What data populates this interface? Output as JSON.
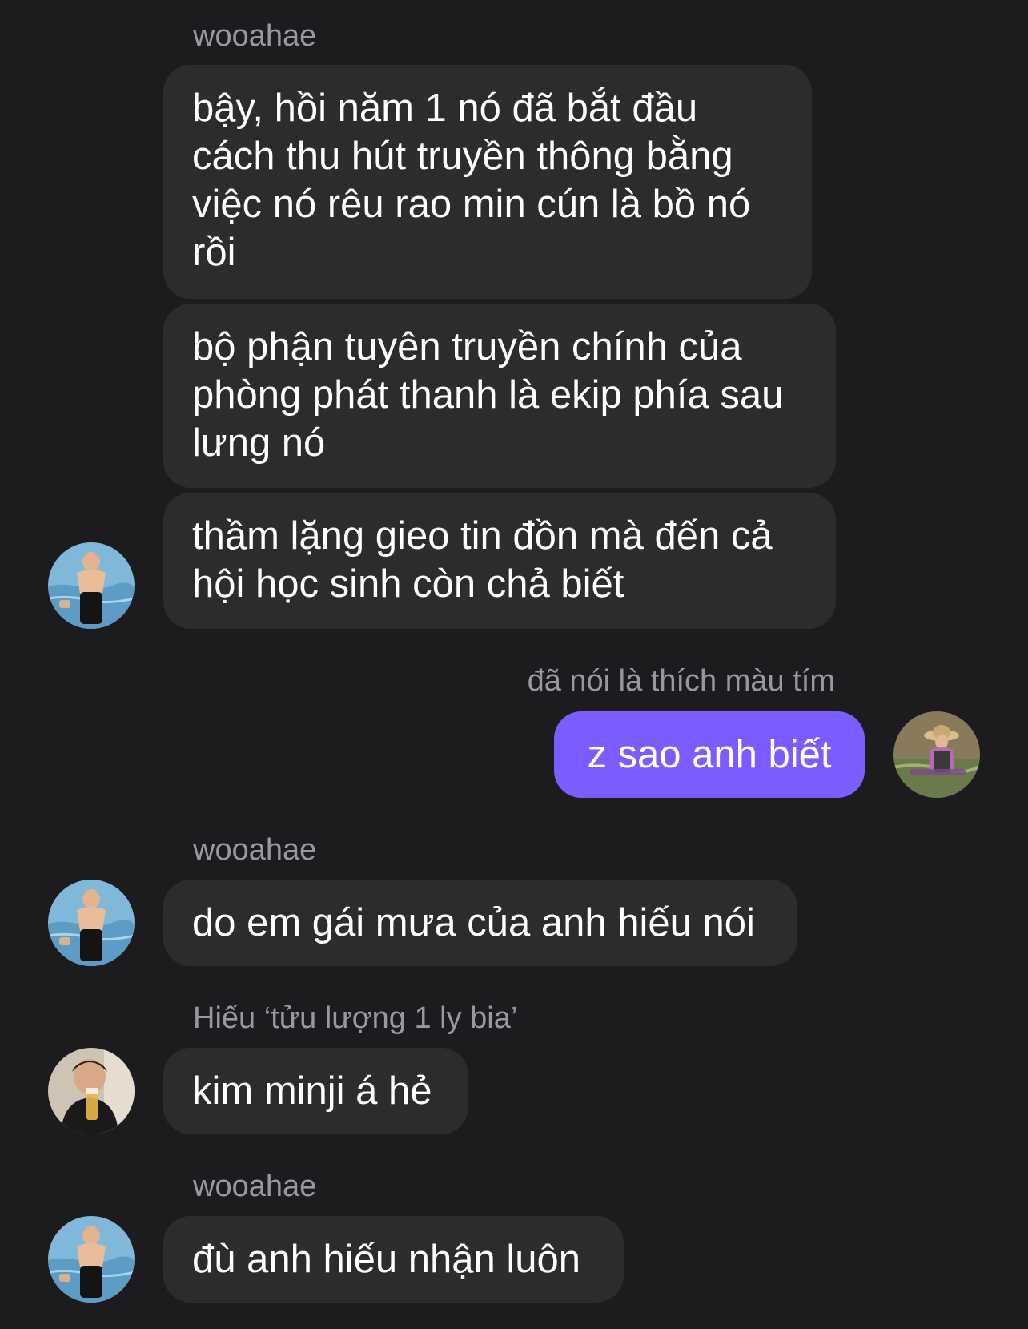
{
  "messages": [
    {
      "sender": "wooahae",
      "text": "bậy, hồi năm 1 nó đã bắt đầu cách thu hút truyền thông bằng việc nó rêu rao min cún là bồ nó rồi"
    },
    {
      "text": "bộ phận tuyên truyền chính của phòng phát thanh là ekip phía sau lưng nó"
    },
    {
      "text": "thầm lặng gieo tin đồn mà đến cả hội học sinh còn chả biết"
    },
    {
      "reply_context": "đã nói là thích màu tím",
      "text": "z sao anh biết",
      "outgoing": true
    },
    {
      "sender": "wooahae",
      "text": "do em gái mưa của anh hiếu nói"
    },
    {
      "sender": "Hiếu ‘tửu lượng 1 ly bia’",
      "text": "kim minji á hẻ"
    },
    {
      "sender": "wooahae",
      "text": "đù anh hiếu nhận luôn"
    }
  ],
  "colors": {
    "background": "#1c1c1e",
    "incoming_bubble": "#2c2c2e",
    "outgoing_bubble": "#7a5cff",
    "sender_label": "#98989f"
  },
  "avatars": {
    "wooahae": "swimmer-photo",
    "me": "field-worker-photo",
    "hieu": "drinking-photo"
  }
}
